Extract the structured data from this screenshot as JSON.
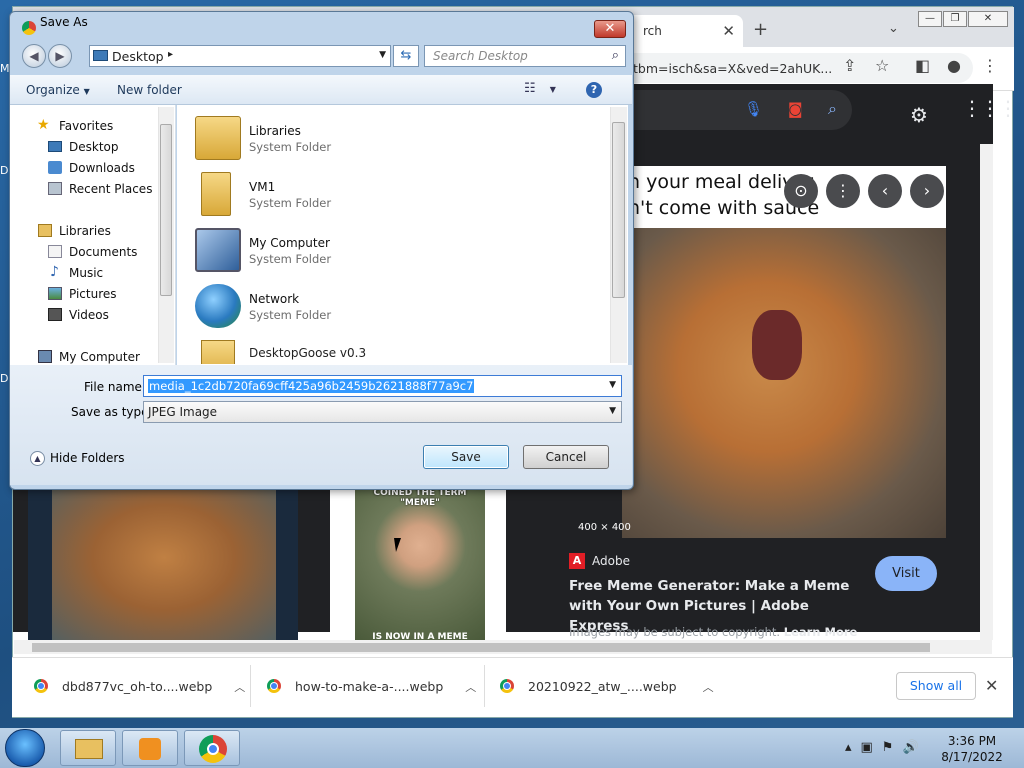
{
  "desktop": {
    "labels": [
      "M",
      "D",
      "D"
    ]
  },
  "browser": {
    "tab_title": "rch",
    "url": "tbm=isch&sa=X&ved=2ahUK...",
    "preview": {
      "caption_line1": "n your meal deliver",
      "caption_line2": "n't come with sauce",
      "dimensions": "400 × 400",
      "source": "Adobe",
      "title": "Free Meme Generator: Make a Meme with Your Own Pictures | Adobe Express",
      "visit_label": "Visit",
      "copyright": "Images may be subject to copyright.",
      "learn_more": "Learn More"
    },
    "thumb2_caption_top": "COINED THE TERM \"MEME\"",
    "thumb2_caption_bottom": "IS NOW IN A MEME"
  },
  "downloads": {
    "items": [
      "dbd877vc_oh-to....webp",
      "how-to-make-a-....webp",
      "20210922_atw_....webp"
    ],
    "show_all": "Show all"
  },
  "taskbar": {
    "time": "3:36 PM",
    "date": "8/17/2022"
  },
  "dialog": {
    "title": "Save As",
    "path": "Desktop",
    "search_placeholder": "Search Desktop",
    "organize": "Organize",
    "new_folder": "New folder",
    "nav": {
      "favorites": "Favorites",
      "desktop": "Desktop",
      "downloads": "Downloads",
      "recent": "Recent Places",
      "libraries": "Libraries",
      "documents": "Documents",
      "music": "Music",
      "pictures": "Pictures",
      "videos": "Videos",
      "computer": "My Computer"
    },
    "files": [
      {
        "name": "Libraries",
        "type": "System Folder"
      },
      {
        "name": "VM1",
        "type": "System Folder"
      },
      {
        "name": "My Computer",
        "type": "System Folder"
      },
      {
        "name": "Network",
        "type": "System Folder"
      },
      {
        "name": "DesktopGoose v0.3",
        "type": ""
      }
    ],
    "file_name_label": "File name:",
    "file_name": "media_1c2db720fa69cff425a96b2459b2621888f77a9c7",
    "save_type_label": "Save as type:",
    "save_type": "JPEG Image",
    "hide_folders": "Hide Folders",
    "save": "Save",
    "cancel": "Cancel"
  }
}
